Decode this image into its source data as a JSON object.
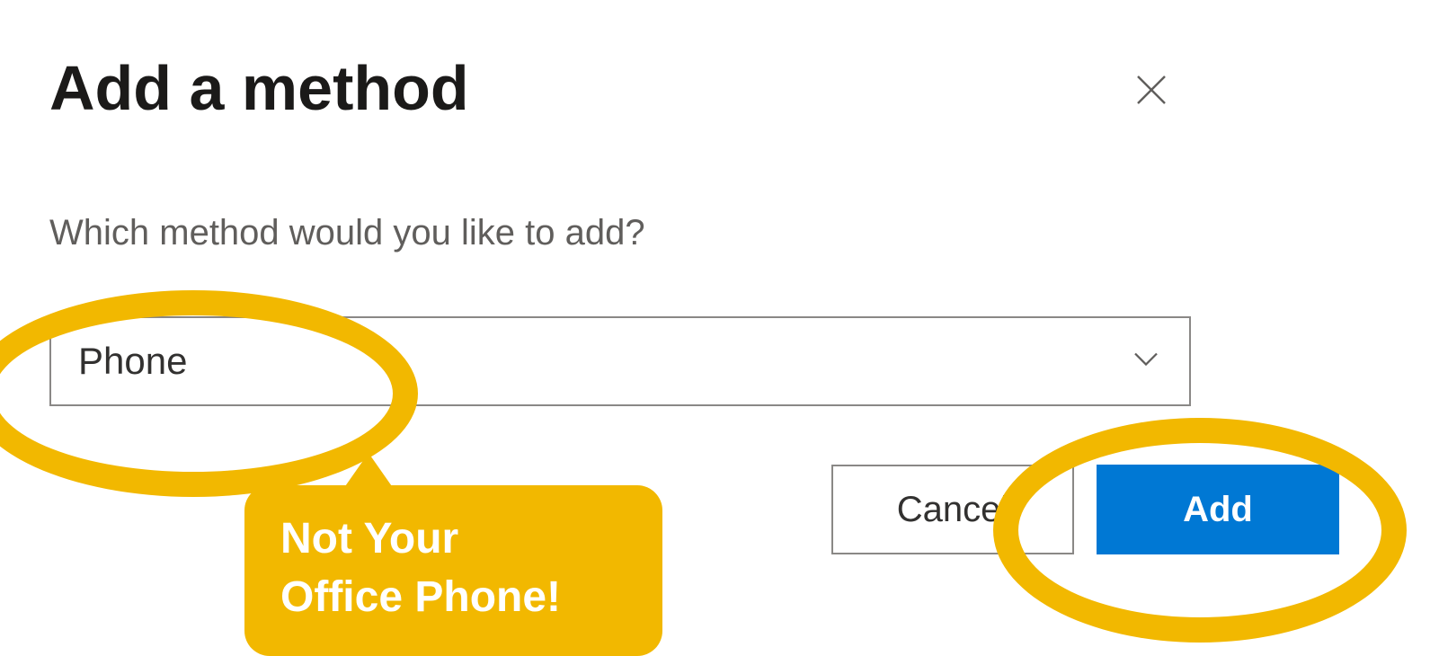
{
  "dialog": {
    "title": "Add a method",
    "question": "Which method would you like to add?",
    "select": {
      "value": "Phone"
    },
    "buttons": {
      "cancel": "Cancel",
      "add": "Add"
    }
  },
  "annotations": {
    "callout_line1": "Not Your",
    "callout_line2": "Office Phone!"
  }
}
